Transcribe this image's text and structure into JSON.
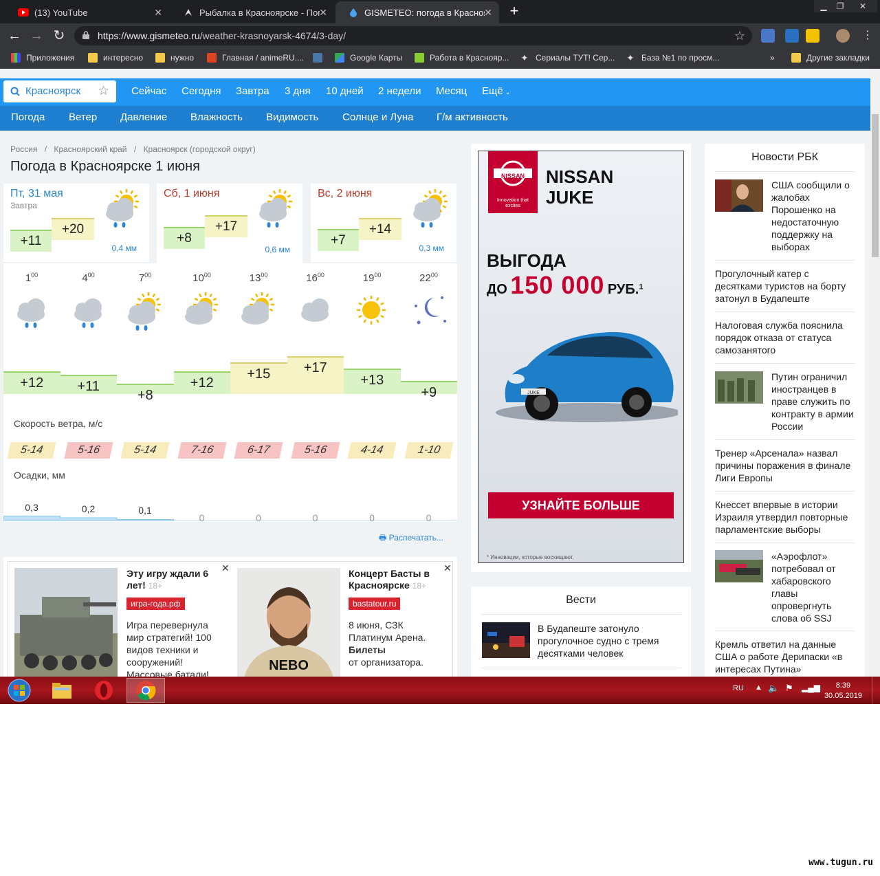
{
  "tabs": [
    {
      "title": "(13) YouTube",
      "icon": "youtube-icon"
    },
    {
      "title": "Рыбалка в Красноярске - Попла",
      "icon": "fish-icon"
    },
    {
      "title": "GISMETEO: погода в Красноярс",
      "icon": "gismeteo-drop-icon",
      "active": true
    }
  ],
  "address": {
    "host": "https://www.gismeteo.ru",
    "path": "/weather-krasnoyarsk-4674/3-day/"
  },
  "bookmarks": [
    {
      "label": "Приложения",
      "icon": "apps-grid-icon"
    },
    {
      "label": "интересно",
      "icon": "folder-icon"
    },
    {
      "label": "нужно",
      "icon": "folder-icon"
    },
    {
      "label": "Главная / animeRU....",
      "icon": "anime-icon"
    },
    {
      "label": "",
      "icon": "vk-icon"
    },
    {
      "label": "Google Карты",
      "icon": "maps-icon"
    },
    {
      "label": "Работа в Краснояр...",
      "icon": "job-icon"
    },
    {
      "label": "Сериалы ТУТ! Сер...",
      "icon": "star-bookmark-icon"
    },
    {
      "label": "База №1 по просм...",
      "icon": "star-bookmark-icon"
    },
    {
      "label": "Другие закладки",
      "icon": "folder-icon"
    }
  ],
  "bookmarks_more": "»",
  "search": {
    "city": "Красноярск"
  },
  "topnav": [
    "Сейчас",
    "Сегодня",
    "Завтра",
    "3 дня",
    "10 дней",
    "2 недели",
    "Месяц",
    "Ещё"
  ],
  "subnav": [
    "Погода",
    "Ветер",
    "Давление",
    "Влажность",
    "Видимость",
    "Солнце и Луна",
    "Г/м активность"
  ],
  "breadcrumb": [
    "Россия",
    "Красноярский край",
    "Красноярск (городской округ)"
  ],
  "page_title": "Погода в Красноярске 1 июня",
  "days": [
    {
      "name": "Пт, 31 мая",
      "sub": "Завтра",
      "low": "+11",
      "high": "+20",
      "precip": "0,4 мм",
      "color": "#2a86d8"
    },
    {
      "name": "Сб, 1 июня",
      "sub": "",
      "low": "+8",
      "high": "+17",
      "precip": "0,6 мм",
      "color": "#c0392b"
    },
    {
      "name": "Вс, 2 июня",
      "sub": "",
      "low": "+7",
      "high": "+14",
      "precip": "0,3 мм",
      "color": "#c0392b"
    }
  ],
  "hours": [
    {
      "h": "1",
      "m": "00",
      "icon": "cloud-rain-icon",
      "temp": "+12",
      "t": 12,
      "wind": "5-14",
      "wind_level": "moderate",
      "precip": "0,3",
      "p": 0.3
    },
    {
      "h": "4",
      "m": "00",
      "icon": "cloud-rain-icon",
      "temp": "+11",
      "t": 11,
      "wind": "5-16",
      "wind_level": "strong",
      "precip": "0,2",
      "p": 0.2
    },
    {
      "h": "7",
      "m": "00",
      "icon": "sun-cloud-rain-icon",
      "temp": "+8",
      "t": 8,
      "wind": "5-14",
      "wind_level": "moderate",
      "precip": "0,1",
      "p": 0.1
    },
    {
      "h": "10",
      "m": "00",
      "icon": "sun-cloud-icon",
      "temp": "+12",
      "t": 12,
      "wind": "7-16",
      "wind_level": "strong",
      "precip": "0",
      "p": 0
    },
    {
      "h": "13",
      "m": "00",
      "icon": "sun-cloud-icon",
      "temp": "+15",
      "t": 15,
      "wind": "6-17",
      "wind_level": "strong",
      "precip": "0",
      "p": 0
    },
    {
      "h": "16",
      "m": "00",
      "icon": "cloud-icon",
      "temp": "+17",
      "t": 17,
      "wind": "5-16",
      "wind_level": "strong",
      "precip": "0",
      "p": 0
    },
    {
      "h": "19",
      "m": "00",
      "icon": "sun-icon",
      "temp": "+13",
      "t": 13,
      "wind": "4-14",
      "wind_level": "moderate",
      "precip": "0",
      "p": 0
    },
    {
      "h": "22",
      "m": "00",
      "icon": "moon-stars-icon",
      "temp": "+9",
      "t": 9,
      "wind": "1-10",
      "wind_level": "moderate",
      "precip": "0",
      "p": 0
    }
  ],
  "labels": {
    "wind": "Скорость ветра, м/с",
    "precip": "Осадки, мм",
    "print": "Распечатать..."
  },
  "ads": [
    {
      "title": "Эту игру ждали 6 лет!",
      "age": "18+",
      "tag": "игра-года.рф",
      "text": "Игра перевернула мир стратегий! 100 видов техники и сооружений! Массовые батали!"
    },
    {
      "title": "Концерт Басты в Красноярске",
      "age": "18+",
      "tag": "bastatour.ru",
      "text1": "8 июня, СЗК Платинум Арена.",
      "text2": "Билеты",
      "text3": "от организатора."
    }
  ],
  "nissan": {
    "brand": "NISSAN",
    "model_line1": "NISSAN",
    "model_line2": "JUKE",
    "tagline": "Innovation that excites",
    "headline": "ВЫГОДА",
    "pre": "ДО",
    "amount": "150 000",
    "cur": "РУБ.",
    "sup": "1",
    "plate": "JUKE",
    "cta": "УЗНАЙТЕ БОЛЬШЕ",
    "note": "* Инновации, которые восхищают."
  },
  "vesti": {
    "title": "Вести",
    "items": [
      "В Будапеште затонуло прогулочное судно с тремя десятками человек"
    ]
  },
  "rbk": {
    "title": "Новости РБК",
    "items": [
      "США сообщили о жалобах Порошенко на недостаточную поддержку на выборах",
      "Прогулочный катер с десятками туристов на борту затонул в Будапеште",
      "Налоговая служба пояснила порядок отказа от статуса самозанятого",
      "Путин ограничил иностранцев в праве служить по контракту в армии России",
      "Тренер «Арсенала» назвал причины поражения в финале Лиги Европы",
      "Кнессет впервые в истории Израиля утвердил повторные парламентские выборы",
      "«Аэрофлот» потребовал от хабаровского главы опровергнуть слова об SSJ",
      "Кремль ответил на данные США о работе Дерипаски «в интересах Путина»"
    ]
  },
  "taskbar": {
    "lang": "RU",
    "time": "8:39",
    "date": "30.05.2019"
  },
  "watermark": "www.tugun.ru",
  "colors": {
    "accent": "#2196f3",
    "subnav": "#1e7fd0",
    "nissan_red": "#c3002f",
    "taskbar": "#a8161d"
  }
}
